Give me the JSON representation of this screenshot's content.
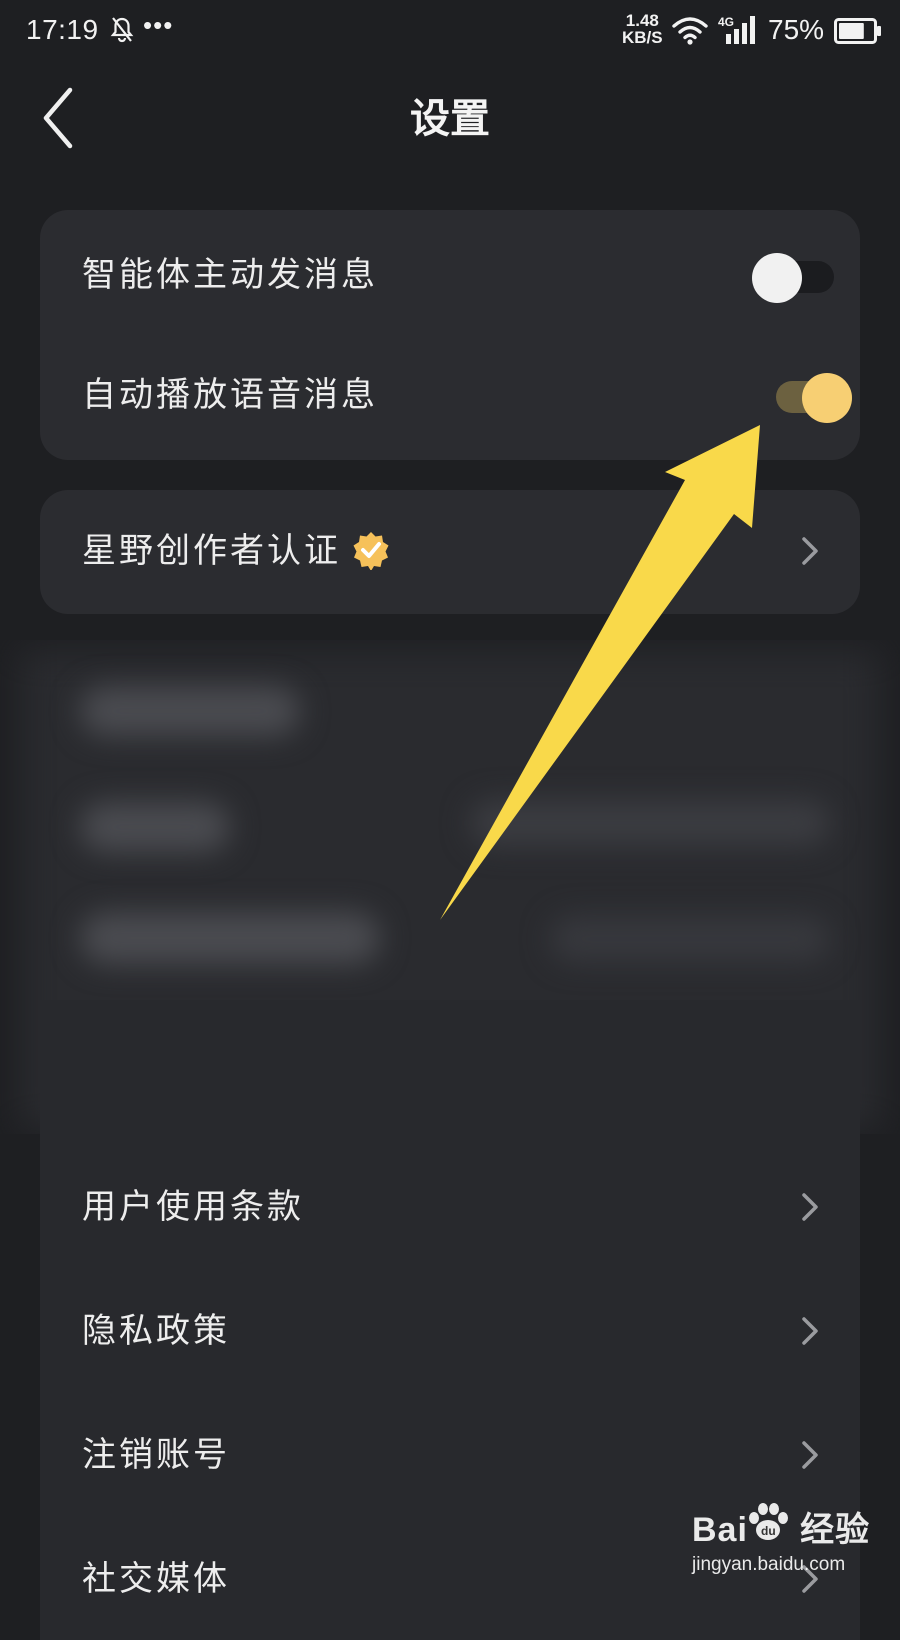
{
  "status_bar": {
    "time": "17:19",
    "dots": "•••",
    "speed_value": "1.48",
    "speed_unit": "KB/S",
    "network": "4G",
    "battery_percent": "75%",
    "battery_level": 0.75
  },
  "header": {
    "title": "设置",
    "back_icon": "chevron-left-icon"
  },
  "settings": {
    "toggles": [
      {
        "label": "智能体主动发消息",
        "enabled": false
      },
      {
        "label": "自动播放语音消息",
        "enabled": true
      }
    ],
    "creator": {
      "label": "星野创作者认证",
      "badge_icon": "verified-badge-icon"
    },
    "links": [
      {
        "label": "用户使用条款"
      },
      {
        "label": "隐私政策"
      },
      {
        "label": "注销账号"
      },
      {
        "label": "社交媒体"
      }
    ]
  },
  "watermark": {
    "brand": "Bai     经验",
    "url": "jingyan.baidu.com"
  },
  "colors": {
    "background": "#1e1f22",
    "card": "#2b2c30",
    "toggle_on": "#f7cf73",
    "arrow": "#f9d94a",
    "badge": "#f6c15a"
  }
}
